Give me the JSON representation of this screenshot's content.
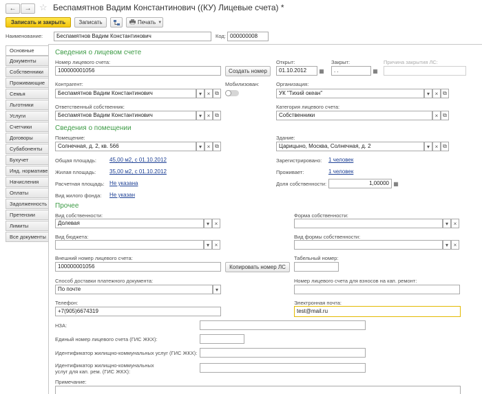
{
  "window": {
    "title": "Беспамятнов Вадим Константинович ((КУ) Лицевые счета) *",
    "back_glyph": "←",
    "forward_glyph": "→",
    "star_glyph": "☆"
  },
  "toolbar": {
    "save_close": "Записать и закрыть",
    "save": "Записать",
    "print": "Печать"
  },
  "header": {
    "name_label": "Наименование:",
    "name_value": "Беспамятнов Вадим Константинович",
    "code_label": "Код:",
    "code_value": "000000008"
  },
  "tabs": [
    "Основные",
    "Документы",
    "Собственники",
    "Проживающие",
    "Семья",
    "Льготники",
    "Услуги",
    "Счетчики",
    "Договоры",
    "Субабоненты",
    "Бухучет",
    "Инд. нормативы",
    "Начисления",
    "Оплаты",
    "Задолженность",
    "Претензии",
    "Лимиты",
    "Все документы"
  ],
  "tabs_visible": [
    "Основные",
    "Документы",
    "Собственники",
    "Проживающие",
    "Семья",
    "Льготники",
    "Услуги",
    "Счетчики",
    "Договоры",
    "Субабоненты",
    "Бухучет",
    "Инд. нормативе",
    "Начисления",
    "Оплаты",
    "Задолженность",
    "Претензии",
    "Лимиты",
    "Все документы"
  ],
  "account": {
    "section": "Сведения о лицевом счете",
    "number_label": "Номер лицевого счета:",
    "number_value": "100000001056",
    "create_number": "Создать номер",
    "opened_label": "Открыт:",
    "opened_value": "01.10.2012",
    "closed_label": "Закрыт:",
    "closed_value": " .  .",
    "close_reason_label": "Причина закрытия ЛС:",
    "counterparty_label": "Контрагент:",
    "counterparty_value": "Беспамятнов Вадим Константинович",
    "mobilized_label": "Мобилизован:",
    "organization_label": "Организация:",
    "organization_value": "УК \"Тихий океан\"",
    "owner_label": "Ответственный собственник:",
    "owner_value": "Беспамятнов Вадим Константинович",
    "category_label": "Категория лицевого счета:",
    "category_value": "Собственники"
  },
  "premises": {
    "section": "Сведения о помещении",
    "room_label": "Помещение:",
    "room_value": "Солнечная, д. 2, кв. 566",
    "building_label": "Здание:",
    "building_value": "Царицыно, Москва, Солнечная, д. 2",
    "total_area_label": "Общая площадь:",
    "total_area_value": "45,00 м2, с 01.10.2012",
    "living_area_label": "Жилая площадь:",
    "living_area_value": "35,00 м2, с 01.10.2012",
    "calc_area_label": "Расчетная площадь:",
    "calc_area_value": "Не указана",
    "fund_type_label": "Вид жилого фонда:",
    "fund_type_value": "Не указан",
    "registered_label": "Зарегистрировано:",
    "registered_value": "1 человек",
    "living_label": "Проживает:",
    "living_value": "1 человек",
    "share_label": "Доля собственности:",
    "share_value": "1,00000"
  },
  "other": {
    "section": "Прочее",
    "ownership_type_label": "Вид собственности:",
    "ownership_type_value": "Долевая",
    "ownership_form_label": "Форма собственности:",
    "budget_type_label": "Вид бюджета:",
    "form_type_label": "Вид формы собственности:",
    "ext_number_label": "Внешний номер лицевого счета:",
    "ext_number_value": "100000001056",
    "copy_number": "Копировать номер ЛС",
    "tab_number_label": "Табельный номер:",
    "delivery_label": "Способ доставки платежного документа:",
    "delivery_value": "По почте",
    "capital_label": "Номер лицевого счета для взносов на кап. ремонт:",
    "phone_label": "Телефон:",
    "phone_value": "+7(905)6674319",
    "email_label": "Электронная почта:",
    "email_value": "test@mail.ru",
    "nza_label": "НЗА:",
    "gis_number_label": "Единый номер лицевого счета (ГИС ЖКХ):",
    "gis_id_label": "Идентификатор жилищно-коммунальных услуг (ГИС ЖКХ):",
    "gis_cap_label_1": "Идентификатор жилищно-коммунальных",
    "gis_cap_label_2": "услуг для кап. рем. (ГИС ЖКХ):",
    "note_label": "Примечание:"
  },
  "colors": {
    "accent_yellow": "#f3c50c",
    "section_green": "#3e9b46",
    "link_blue": "#1c3f94"
  }
}
